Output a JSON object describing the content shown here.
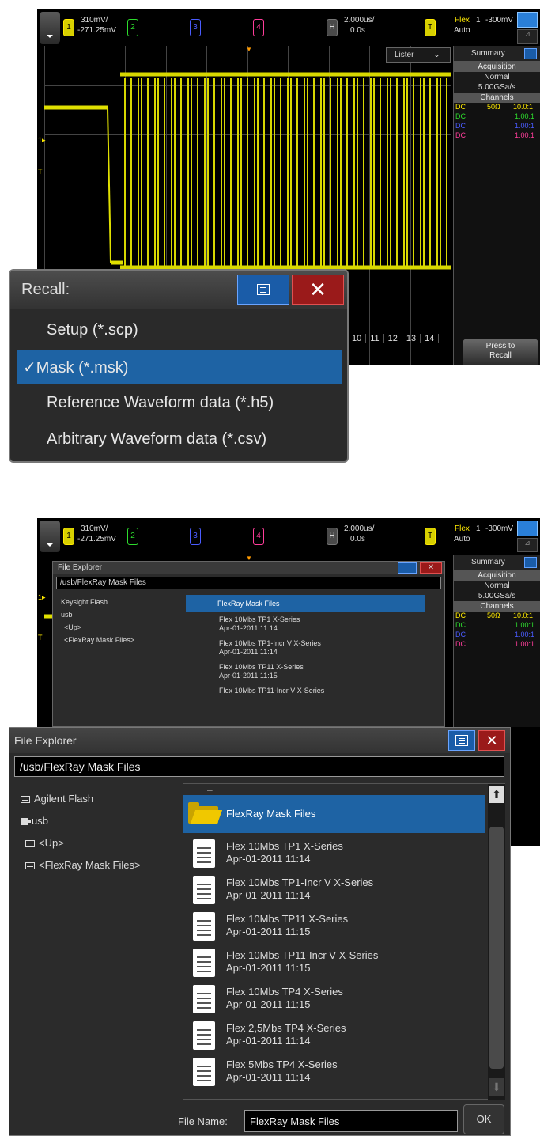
{
  "topbar": {
    "ch1_label": "1",
    "ch1_scale": "310mV/",
    "ch1_offset": "-271.25mV",
    "ch2_label": "2",
    "ch3_label": "3",
    "ch4_label": "4",
    "horiz_label": "H",
    "horiz_scale": "2.000us/",
    "horiz_delay": "0.0s",
    "trig_label": "T",
    "trig_source": "Flex",
    "trig_num": "1",
    "trig_level": "-300mV",
    "trig_mode": "Auto"
  },
  "lister_tab": "Lister",
  "summary": {
    "title": "Summary",
    "acquisition_header": "Acquisition",
    "acq_mode": "Normal",
    "sample_rate": "5.00GSa/s",
    "channels_header": "Channels",
    "rows": [
      {
        "coupling": "DC",
        "imp": "50Ω",
        "probe": "10.0:1",
        "color": "#ffea00"
      },
      {
        "coupling": "DC",
        "imp": "",
        "probe": "1.00:1",
        "color": "#2ddc2d"
      },
      {
        "coupling": "DC",
        "imp": "",
        "probe": "1.00:1",
        "color": "#4a5cff"
      },
      {
        "coupling": "DC",
        "imp": "",
        "probe": "1.00:1",
        "color": "#ff3d9a"
      }
    ]
  },
  "num_strip": [
    "10",
    "11",
    "12",
    "13",
    "14"
  ],
  "press_recall": {
    "line1": "Press to",
    "line2": "Recall"
  },
  "recall": {
    "title": "Recall:",
    "items": [
      {
        "label": "Setup (*.scp)",
        "selected": false
      },
      {
        "label": "Mask (*.msk)",
        "selected": true
      },
      {
        "label": "Reference Waveform data (*.h5)",
        "selected": false
      },
      {
        "label": "Arbitrary Waveform data (*.csv)",
        "selected": false
      }
    ],
    "check": "✓"
  },
  "fe_small": {
    "title": "File Explorer",
    "path": "/usb/FlexRay Mask Files",
    "tree": [
      "Keysight Flash",
      "usb",
      "<Up>",
      "<FlexRay Mask Files>"
    ],
    "folder": "FlexRay Mask Files",
    "files": [
      {
        "name": "Flex 10Mbs TP1 X-Series",
        "date": "Apr-01-2011 11:14"
      },
      {
        "name": "Flex 10Mbs TP1-Incr V X-Series",
        "date": "Apr-01-2011 11:14"
      },
      {
        "name": "Flex 10Mbs TP11 X-Series",
        "date": "Apr-01-2011 11:15"
      },
      {
        "name": "Flex 10Mbs TP11-Incr V X-Series",
        "date": ""
      }
    ]
  },
  "fe": {
    "title": "File Explorer",
    "close": "✕",
    "path": "/usb/FlexRay Mask Files",
    "tree": [
      {
        "label": "Agilent Flash",
        "icon": "drive-icon"
      },
      {
        "label": "usb",
        "icon": "usb-icon"
      },
      {
        "label": "<Up>",
        "icon": "up-folder-icon"
      },
      {
        "label": "<FlexRay Mask Files>",
        "icon": "folder-icon"
      }
    ],
    "dash": "–",
    "folder": "FlexRay Mask Files",
    "files": [
      {
        "name": "Flex 10Mbs TP1 X-Series",
        "date": "Apr-01-2011 11:14"
      },
      {
        "name": "Flex 10Mbs TP1-Incr V X-Series",
        "date": "Apr-01-2011 11:14"
      },
      {
        "name": "Flex 10Mbs TP11 X-Series",
        "date": "Apr-01-2011 11:15"
      },
      {
        "name": "Flex 10Mbs TP11-Incr V X-Series",
        "date": "Apr-01-2011 11:15"
      },
      {
        "name": "Flex 10Mbs TP4 X-Series",
        "date": "Apr-01-2011 11:15"
      },
      {
        "name": "Flex 2,5Mbs TP4 X-Series",
        "date": "Apr-01-2011 11:14"
      },
      {
        "name": "Flex 5Mbs TP4 X-Series",
        "date": "Apr-01-2011 11:14"
      }
    ],
    "file_name_label": "File Name:",
    "file_name_value": "FlexRay Mask Files",
    "ok_label": "OK",
    "scroll_up": "⬆",
    "scroll_down": "⬇"
  }
}
